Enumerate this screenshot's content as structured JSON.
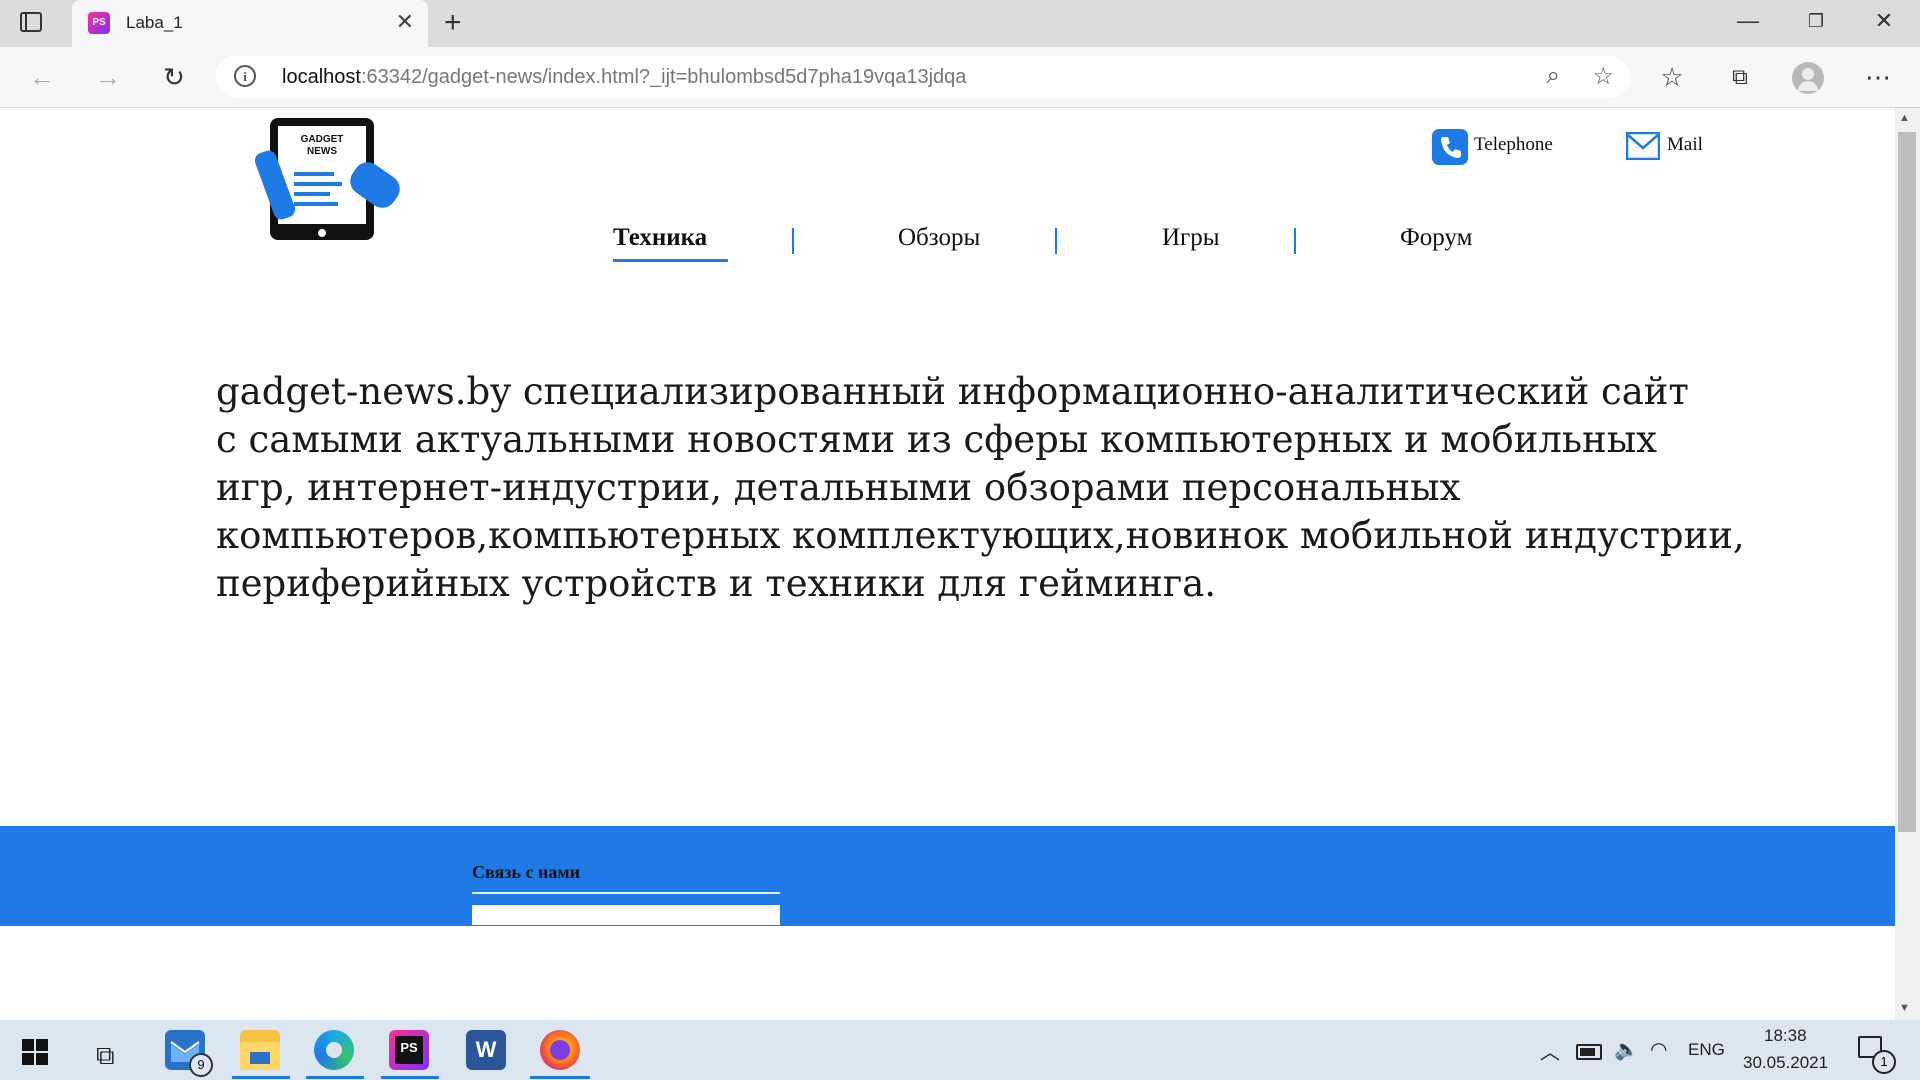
{
  "browser": {
    "tab_title": "Laba_1",
    "tab_favicon_text": "PS",
    "url_host": "localhost",
    "url_rest": ":63342/gadget-news/index.html?_ijt=bhulombsd5d7pha19vqa13jdqa"
  },
  "site": {
    "logo_text_line1": "GADGET",
    "logo_text_line2": "NEWS",
    "contacts": {
      "phone": "Telephone",
      "mail": "Mail"
    },
    "menu": [
      "Техника",
      "Обзоры",
      "Игры",
      "Форум"
    ],
    "hero_lines": [
      "gadget-news.by специализированный информационно-аналитический сайт",
      "с самыми актуальными новостями из сферы компьютерных и мобильных",
      "игр, интернет-индустрии, детальными обзорами персональных",
      "компьютеров,компьютерных комплектующих,новинок мобильной индустрии,",
      "периферийных устройств и техники для гейминга."
    ],
    "footer_title": "Связь с нами",
    "colors": {
      "accent": "#1e7ae6"
    }
  },
  "taskbar": {
    "mail_badge": "9",
    "lang": "ENG",
    "time": "18:38",
    "date": "30.05.2021",
    "notif_badge": "1",
    "apps": [
      "start-icon",
      "task-view-icon",
      "mail-icon",
      "file-explorer-icon",
      "edge-icon",
      "phpstorm-icon",
      "word-icon",
      "firefox-icon"
    ]
  }
}
